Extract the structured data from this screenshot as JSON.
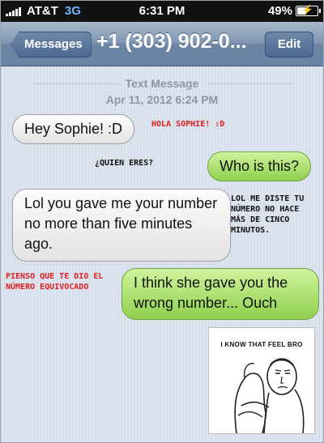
{
  "status_bar": {
    "carrier": "AT&T",
    "network": "3G",
    "time": "6:31 PM",
    "battery": "49%"
  },
  "nav": {
    "back_label": "Messages",
    "title": "+1 (303) 902-0...",
    "edit_label": "Edit"
  },
  "thread_meta": {
    "label": "Text Message",
    "datetime": "Apr 11, 2012 6:24 PM"
  },
  "messages": [
    {
      "text": "Hey Sophie! :D"
    },
    {
      "text": "Who is this?"
    },
    {
      "text": "Lol you gave me your number no more than five minutes ago."
    },
    {
      "text": "I think she gave you the wrong number... Ouch"
    }
  ],
  "annotations": [
    {
      "text": "HOLA SOPHIE! :D",
      "color": "#e02020"
    },
    {
      "text": "¿QUIEN ERES?",
      "color": "#111111"
    },
    {
      "text": "LOL ME DISTE TU NÚMERO NO HACE MÁS DE CINCO MINUTOS.",
      "color": "#111111"
    },
    {
      "text": "PIENSO QUE TE DIO EL NÚMERO EQUIVOCADO",
      "color": "#e02020"
    }
  ],
  "meme": {
    "caption": "I KNOW THAT FEEL BRO"
  }
}
